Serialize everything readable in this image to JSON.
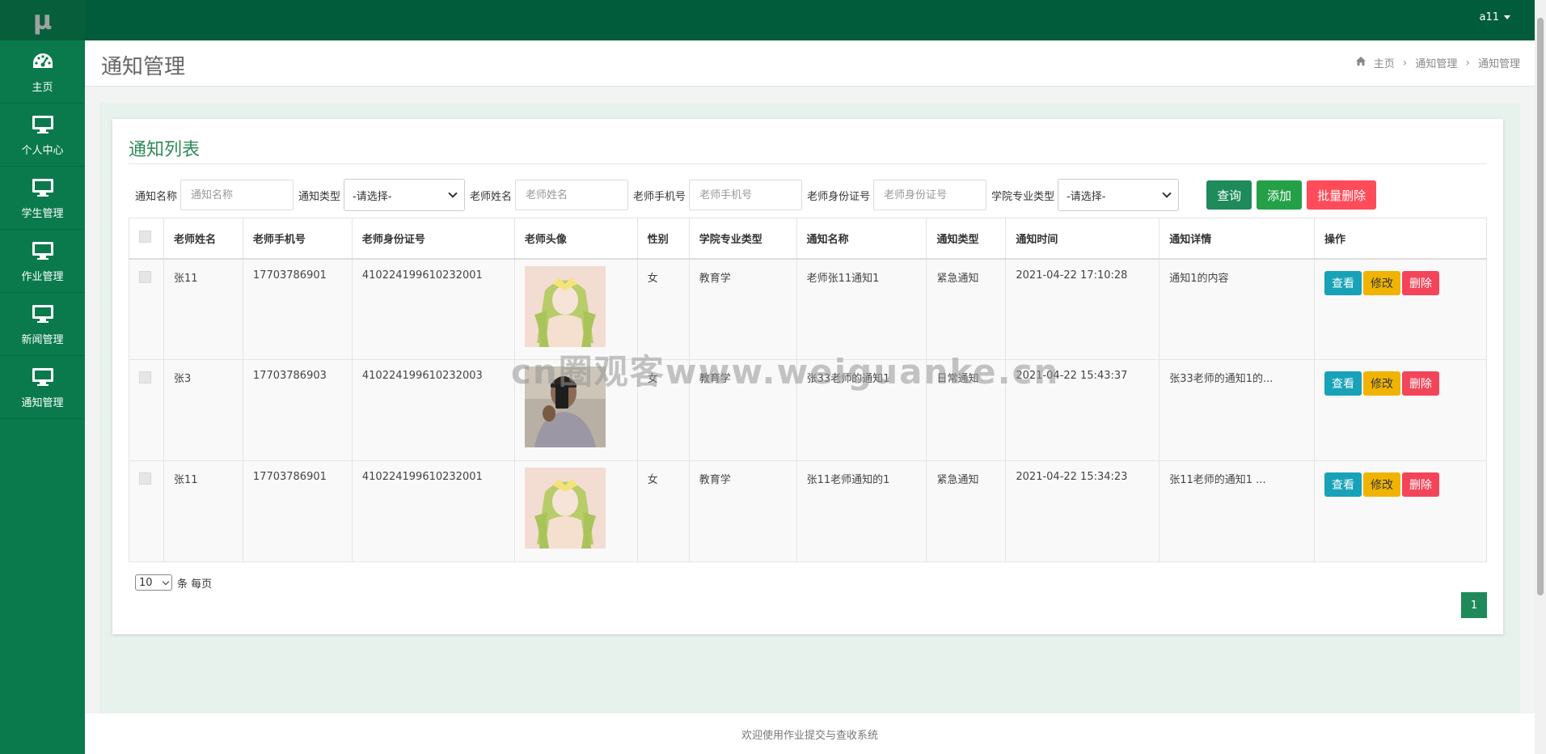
{
  "app": {
    "logo": "µ"
  },
  "sidebar": {
    "items": [
      {
        "label": "主页",
        "icon": "dashboard-icon"
      },
      {
        "label": "个人中心",
        "icon": "monitor-icon"
      },
      {
        "label": "学生管理",
        "icon": "monitor-icon"
      },
      {
        "label": "作业管理",
        "icon": "monitor-icon"
      },
      {
        "label": "新闻管理",
        "icon": "monitor-icon"
      },
      {
        "label": "通知管理",
        "icon": "monitor-icon"
      }
    ]
  },
  "topbar": {
    "user": "a11"
  },
  "header": {
    "title": "通知管理",
    "breadcrumb": [
      "主页",
      "通知管理",
      "通知管理"
    ]
  },
  "panel": {
    "title": "通知列表"
  },
  "filters": {
    "notice_name_label": "通知名称",
    "notice_name_placeholder": "通知名称",
    "notice_type_label": "通知类型",
    "notice_type_value": "-请选择-",
    "teacher_name_label": "老师姓名",
    "teacher_name_placeholder": "老师姓名",
    "teacher_phone_label": "老师手机号",
    "teacher_phone_placeholder": "老师手机号",
    "teacher_id_label": "老师身份证号",
    "teacher_id_placeholder": "老师身份证号",
    "major_type_label": "学院专业类型",
    "major_type_value": "-请选择-",
    "query_btn": "查询",
    "add_btn": "添加",
    "batch_delete_btn": "批量删除"
  },
  "table": {
    "headers": [
      "老师姓名",
      "老师手机号",
      "老师身份证号",
      "老师头像",
      "性别",
      "学院专业类型",
      "通知名称",
      "通知类型",
      "通知时间",
      "通知详情",
      "操作"
    ],
    "rows": [
      {
        "name": "张11",
        "phone": "17703786901",
        "id_card": "410224199610232001",
        "avatar": "anime-girl",
        "gender": "女",
        "major": "教育学",
        "notice_name": "老师张11通知1",
        "notice_type": "紧急通知",
        "time": "2021-04-22 17:10:28",
        "detail": "通知1的内容"
      },
      {
        "name": "张3",
        "phone": "17703786903",
        "id_card": "410224199610232003",
        "avatar": "selfie",
        "gender": "女",
        "major": "教育学",
        "notice_name": "张33老师的通知1",
        "notice_type": "日常通知",
        "time": "2021-04-22 15:43:37",
        "detail": "张33老师的通知1的..."
      },
      {
        "name": "张11",
        "phone": "17703786901",
        "id_card": "410224199610232001",
        "avatar": "anime-girl",
        "gender": "女",
        "major": "教育学",
        "notice_name": "张11老师通知的1",
        "notice_type": "紧急通知",
        "time": "2021-04-22 15:34:23",
        "detail": "张11老师的通知1 ..."
      }
    ],
    "actions": {
      "view": "查看",
      "edit": "修改",
      "delete": "删除"
    }
  },
  "pagination": {
    "page_size": "10",
    "per_page_label": "条 每页",
    "current_page": "1"
  },
  "footer": {
    "text": "欢迎使用作业提交与查收系统"
  },
  "watermark": "cn圈观客www.weiguanke.cn",
  "colors": {
    "sidebar": "#0a7a4c",
    "topbar": "#005c3b",
    "accent": "#2e8b57",
    "view": "#17a2b8",
    "edit": "#f0b400",
    "delete": "#f34559"
  }
}
